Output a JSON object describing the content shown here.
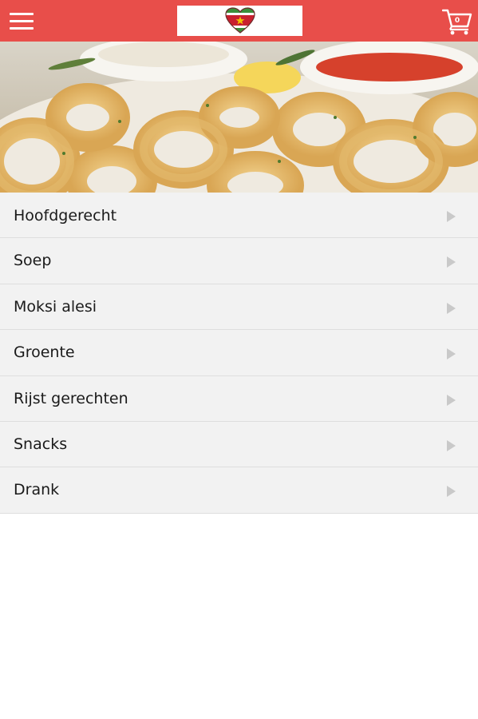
{
  "header": {
    "menu_icon": "hamburger-menu-icon",
    "logo_icon": "suriname-flag-heart-icon",
    "cart_icon": "shopping-cart-icon",
    "cart_count": "0",
    "colors": {
      "bar": "#e84e4a",
      "logo_bg": "#ffffff"
    }
  },
  "hero": {
    "image": "fried-calamari-with-dipping-sauces"
  },
  "menu": {
    "items": [
      {
        "label": "Hoofdgerecht"
      },
      {
        "label": "Soep"
      },
      {
        "label": "Moksi alesi"
      },
      {
        "label": "Groente"
      },
      {
        "label": "Rijst gerechten"
      },
      {
        "label": "Snacks"
      },
      {
        "label": "Drank"
      }
    ],
    "arrow_icon": "chevron-right-icon"
  }
}
